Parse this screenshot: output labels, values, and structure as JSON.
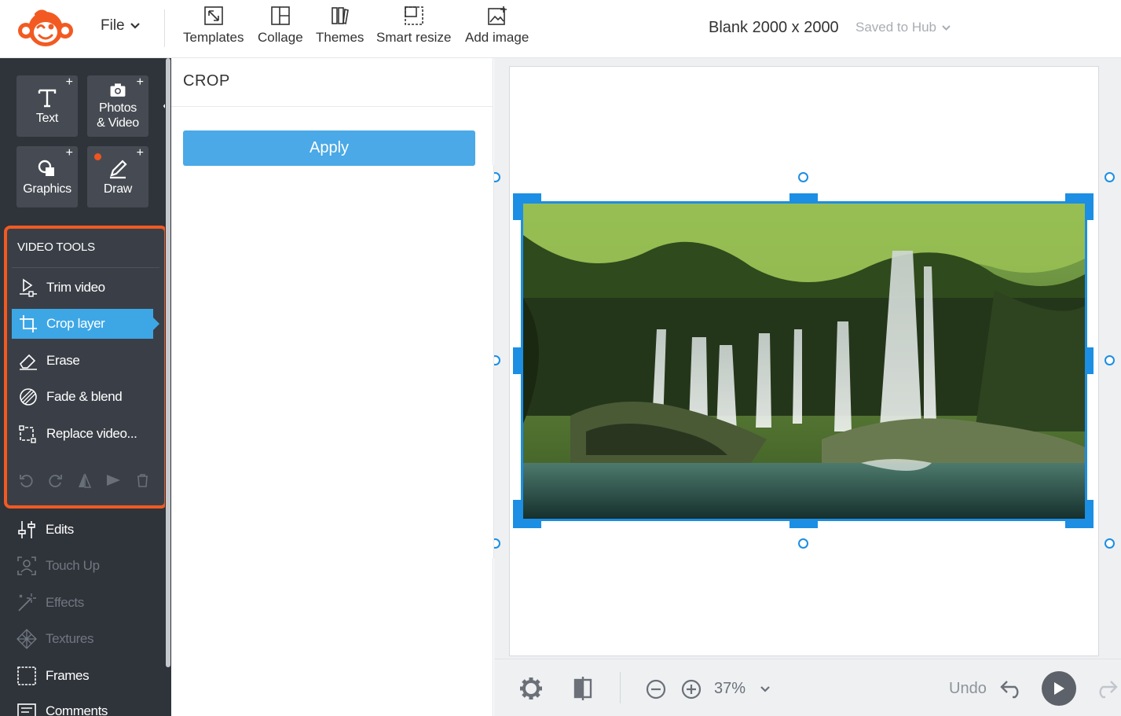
{
  "header": {
    "file_label": "File",
    "tools": [
      {
        "label": "Templates",
        "icon": "templates-icon"
      },
      {
        "label": "Collage",
        "icon": "collage-icon"
      },
      {
        "label": "Themes",
        "icon": "themes-icon"
      },
      {
        "label": "Smart resize",
        "icon": "smart-resize-icon"
      },
      {
        "label": "Add image",
        "icon": "add-image-icon"
      }
    ],
    "document_title": "Blank 2000 x 2000",
    "save_status": "Saved to Hub"
  },
  "sidebar": {
    "tiles": [
      {
        "label": "Text",
        "icon": "text-icon"
      },
      {
        "label": "Photos\n& Video",
        "icon": "camera-icon"
      },
      {
        "label": "Graphics",
        "icon": "graphics-icon"
      },
      {
        "label": "Draw",
        "icon": "pencil-icon"
      }
    ],
    "plus": "+",
    "video_tools": {
      "title": "VIDEO TOOLS",
      "items": [
        {
          "label": "Trim video",
          "icon": "trim-video-icon",
          "active": false
        },
        {
          "label": "Crop layer",
          "icon": "crop-icon",
          "active": true
        },
        {
          "label": "Erase",
          "icon": "eraser-icon",
          "active": false
        },
        {
          "label": "Fade & blend",
          "icon": "fade-blend-icon",
          "active": false
        },
        {
          "label": "Replace video...",
          "icon": "replace-icon",
          "active": false
        }
      ]
    },
    "menu": [
      {
        "label": "Edits",
        "icon": "sliders-icon",
        "enabled": true
      },
      {
        "label": "Touch Up",
        "icon": "face-scan-icon",
        "enabled": false
      },
      {
        "label": "Effects",
        "icon": "magic-wand-icon",
        "enabled": false
      },
      {
        "label": "Textures",
        "icon": "texture-icon",
        "enabled": false
      },
      {
        "label": "Frames",
        "icon": "frame-icon",
        "enabled": true
      },
      {
        "label": "Comments",
        "icon": "comment-icon",
        "enabled": true
      }
    ]
  },
  "panel": {
    "title": "CROP",
    "apply_label": "Apply"
  },
  "bottom_bar": {
    "zoom_level": "37%",
    "undo_label": "Undo"
  },
  "colors": {
    "accent": "#4aa9e6",
    "selection": "#1c8ee3",
    "highlight_border": "#f25a22",
    "sidebar_bg": "#2f333a"
  }
}
